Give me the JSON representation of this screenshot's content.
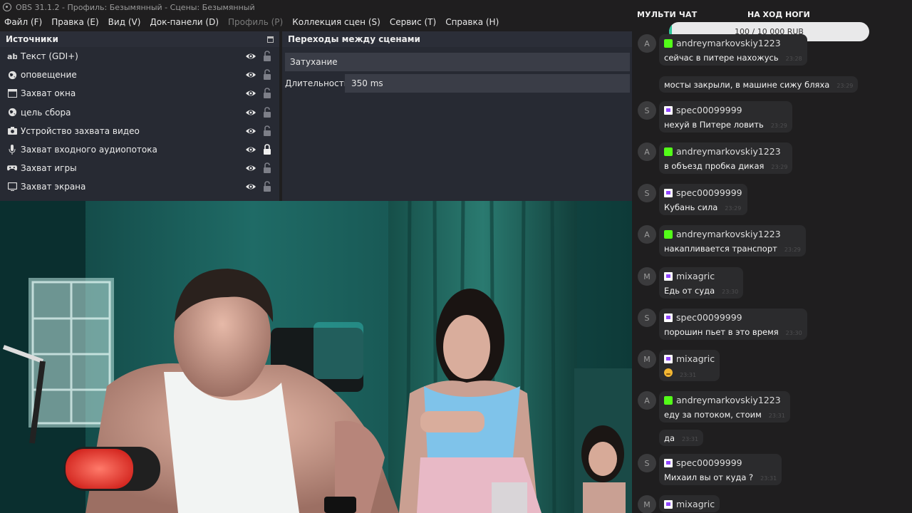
{
  "window": {
    "title": "OBS 31.1.2 - Профиль: Безымянный - Сцены: Безымянный"
  },
  "menu": [
    {
      "label": "Файл (F)",
      "enabled": true
    },
    {
      "label": "Правка (E)",
      "enabled": true
    },
    {
      "label": "Вид (V)",
      "enabled": true
    },
    {
      "label": "Док-панели (D)",
      "enabled": true
    },
    {
      "label": "Профиль (P)",
      "enabled": false
    },
    {
      "label": "Коллекция сцен (S)",
      "enabled": true
    },
    {
      "label": "Сервис (T)",
      "enabled": true
    },
    {
      "label": "Справка (H)",
      "enabled": true
    }
  ],
  "sources": {
    "title": "Источники",
    "items": [
      {
        "label": "Текст (GDI+)",
        "icon": "text-icon",
        "visible": true,
        "locked": false
      },
      {
        "label": "оповещение",
        "icon": "browser-icon",
        "visible": true,
        "locked": false
      },
      {
        "label": "Захват окна",
        "icon": "window-icon",
        "visible": true,
        "locked": false
      },
      {
        "label": "цель сбора",
        "icon": "browser-icon",
        "visible": true,
        "locked": false
      },
      {
        "label": "Устройство захвата видео",
        "icon": "camera-icon",
        "visible": true,
        "locked": false
      },
      {
        "label": "Захват входного аудиопотока",
        "icon": "microphone-icon",
        "visible": true,
        "locked": true
      },
      {
        "label": "Захват игры",
        "icon": "gamepad-icon",
        "visible": true,
        "locked": false
      },
      {
        "label": "Захват экрана",
        "icon": "monitor-icon",
        "visible": true,
        "locked": false
      }
    ]
  },
  "transitions": {
    "title": "Переходы между сценами",
    "selected": "Затухание",
    "duration_label": "Длительность",
    "duration_value": "350 ms"
  },
  "chat": {
    "title": "МУЛЬТИ ЧАТ",
    "goal": {
      "title": "НА ХОД НОГИ",
      "text": "100 / 10 000 RUB",
      "progress": 0.01,
      "color": "#2ec59b"
    },
    "colors": {
      "kick": "#53fc18",
      "twitch": "#9146ff"
    },
    "messages": [
      {
        "avatar": "A",
        "user": "andreymarkovskiy1223",
        "platform": "kick",
        "text": "сейчас в питере нахожусь",
        "time": "23:28"
      },
      {
        "avatar": "",
        "user": "",
        "platform": "",
        "text": "мосты закрыли, в машине сижу бляха",
        "time": "23:29"
      },
      {
        "avatar": "S",
        "user": "spec00099999",
        "platform": "twitch",
        "text": "нехуй в Питере ловить",
        "time": "23:29"
      },
      {
        "avatar": "A",
        "user": "andreymarkovskiy1223",
        "platform": "kick",
        "text": "в объезд пробка дикая",
        "time": "23:29"
      },
      {
        "avatar": "S",
        "user": "spec00099999",
        "platform": "twitch",
        "text": "Кубань сила",
        "time": "23:29"
      },
      {
        "avatar": "A",
        "user": "andreymarkovskiy1223",
        "platform": "kick",
        "text": "накапливается транспорт",
        "time": "23:29"
      },
      {
        "avatar": "M",
        "user": "mixagric",
        "platform": "twitch",
        "text": "Едь от суда",
        "time": "23:30"
      },
      {
        "avatar": "S",
        "user": "spec00099999",
        "platform": "twitch",
        "text": "порошин пьет в это время",
        "time": "23:30"
      },
      {
        "avatar": "M",
        "user": "mixagric",
        "platform": "twitch",
        "text": "",
        "emoji": "grimace-emoji",
        "time": "23:31"
      },
      {
        "avatar": "A",
        "user": "andreymarkovskiy1223",
        "platform": "kick",
        "text": "еду за потоком, стоим",
        "time": "23:31"
      },
      {
        "avatar": "",
        "user": "",
        "platform": "",
        "text": "да",
        "time": "23:31"
      },
      {
        "avatar": "S",
        "user": "spec00099999",
        "platform": "twitch",
        "text": "Михаил вы от куда ?",
        "time": "23:31"
      },
      {
        "avatar": "M",
        "user": "mixagric",
        "platform": "twitch",
        "text": "",
        "time": ""
      }
    ]
  }
}
